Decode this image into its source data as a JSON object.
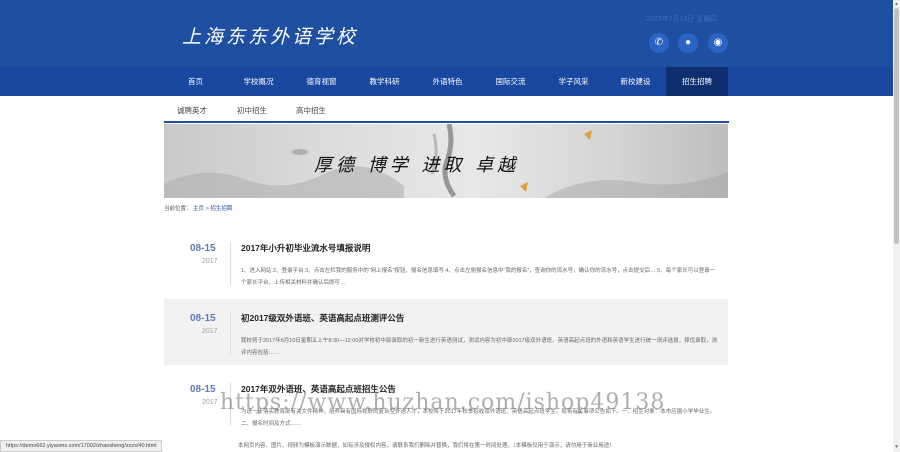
{
  "header": {
    "logo": "上海东东外语学校",
    "date": "2023年7月13日 星期四",
    "social": [
      {
        "icon": "phone-icon",
        "glyph": "✆"
      },
      {
        "icon": "wechat-icon",
        "glyph": "●"
      },
      {
        "icon": "weibo-icon",
        "glyph": "◉"
      }
    ]
  },
  "nav": {
    "items": [
      "首页",
      "学校概况",
      "德育视窗",
      "教学科研",
      "外语特色",
      "国际交流",
      "学子风采",
      "新校建设",
      "招生招聘"
    ],
    "active_index": 8
  },
  "subnav": {
    "items": [
      "诚聘英才",
      "初中招生",
      "高中招生"
    ]
  },
  "banner": {
    "text": "厚德 博学 进取 卓越"
  },
  "breadcrumb": {
    "label": "当前位置：",
    "home": "主页",
    "sep": ">",
    "current": "招生招聘"
  },
  "news": [
    {
      "date": "08-15",
      "year": "2017",
      "title": "2017年小升初毕业流水号填报说明",
      "excerpt": "1、进入网站 2、登录平台 3、点击左栏我的服务中的“网上报名”按钮，报名信息填写 4、点击左侧报名信息中“我的报名”，查询你的流水号，确认你的流水号，点击提交后… 5、每个家长可以登录一个家长平台，上传相关材料并确认后即可…"
    },
    {
      "date": "08-15",
      "year": "2017",
      "title": "初2017级双外语班、英语高起点班测评公告",
      "excerpt": "我校将于2017年8月10日星期五上午8:30—12:00对学校初中部录取的初一新生进行英语测试，测试内容为初中部2017级双外语班、英语高起点班的外语和英语学生进行统一测评选拔，择优录取，测评内容包括……"
    },
    {
      "date": "08-15",
      "year": "2017",
      "title": "2017年双外语班、英语高起点班招生公告",
      "excerpt": "为进一步落实教育部有关文件精神，培养具有国际视野的复合型外语人才，本校将于2017年秋季招收双外语班、英语高起点班学生，现将有关事项公告如下。一、招生对象：本市应届小学毕业生。二、报名时间及方式……"
    }
  ],
  "footer": {
    "text": "本网页内容、图片、视频为模板演示数据，如有涉及侵权内容，请联系我们删除并替换，我们将在第一时间处理。（本模板仅用于演示，请勿用于商业用途）"
  },
  "watermark": "https://www.huzhan.com/ishop49138",
  "status_bar": {
    "url": "https://demo662.yiyaoms.com/17002/zhaosheng/zzzs/40.html"
  }
}
